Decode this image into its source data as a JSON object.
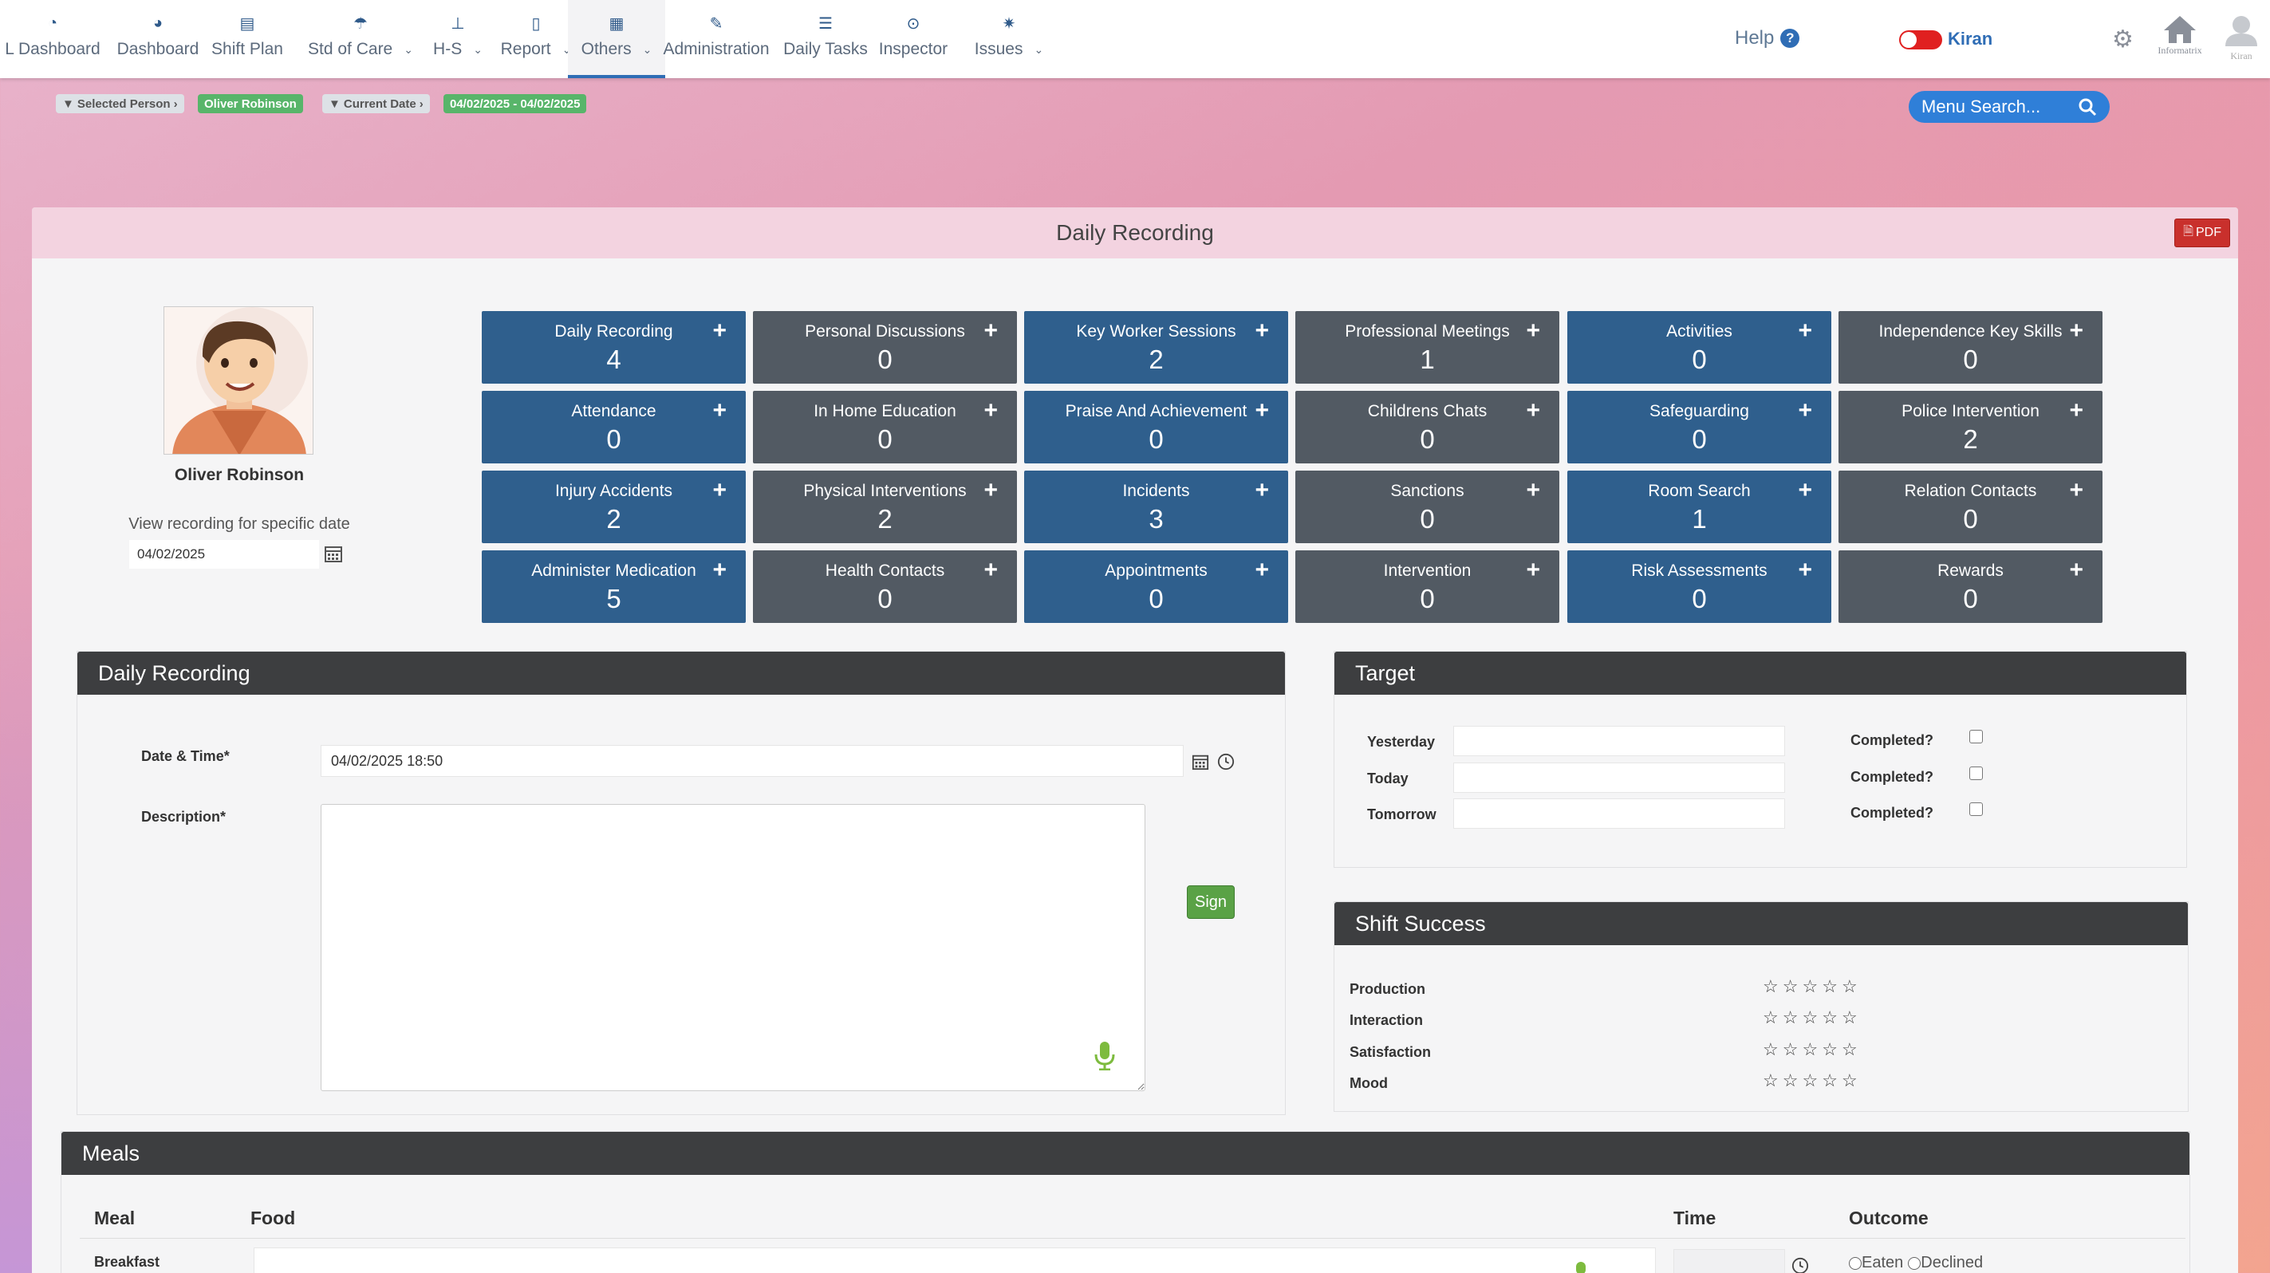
{
  "nav": {
    "items": [
      {
        "label": "L Dashboard",
        "icon": "gauge-icon",
        "caret": false
      },
      {
        "label": "Dashboard",
        "icon": "speedometer-icon",
        "caret": false
      },
      {
        "label": "Shift Plan",
        "icon": "calendar-icon",
        "caret": false
      },
      {
        "label": "Std of Care",
        "icon": "umbrella-icon",
        "caret": true
      },
      {
        "label": "H-S",
        "icon": "extinguisher-icon",
        "caret": true
      },
      {
        "label": "Report",
        "icon": "document-icon",
        "caret": true
      },
      {
        "label": "Others",
        "icon": "grid-icon",
        "caret": true,
        "active": true
      },
      {
        "label": "Administration",
        "icon": "wrench-icon",
        "caret": false
      },
      {
        "label": "Daily Tasks",
        "icon": "tasks-icon",
        "caret": false
      },
      {
        "label": "Inspector",
        "icon": "magnifier-icon",
        "caret": false
      },
      {
        "label": "Issues",
        "icon": "bug-icon",
        "caret": true
      }
    ],
    "help": "Help",
    "user": "Kiran",
    "home_caption": "Informatrix",
    "avatar_caption": "Kiran"
  },
  "filters": {
    "selected_person_label": "Selected Person",
    "selected_person_value": "Oliver Robinson",
    "current_date_label": "Current Date",
    "current_date_value": "04/02/2025 - 04/02/2025"
  },
  "menu_search": {
    "placeholder": "Menu Search..."
  },
  "panel": {
    "title": "Daily Recording",
    "pdf_label": "PDF"
  },
  "profile": {
    "name": "Oliver Robinson",
    "view_label": "View recording for specific date",
    "date": "04/02/2025"
  },
  "tiles": [
    {
      "label": "Daily Recording",
      "count": "4",
      "color": "blue"
    },
    {
      "label": "Personal Discussions",
      "count": "0",
      "color": "grey"
    },
    {
      "label": "Key Worker Sessions",
      "count": "2",
      "color": "blue"
    },
    {
      "label": "Professional Meetings",
      "count": "1",
      "color": "grey"
    },
    {
      "label": "Activities",
      "count": "0",
      "color": "blue"
    },
    {
      "label": "Independence Key Skills",
      "count": "0",
      "color": "grey"
    },
    {
      "label": "Attendance",
      "count": "0",
      "color": "blue"
    },
    {
      "label": "In Home Education",
      "count": "0",
      "color": "grey"
    },
    {
      "label": "Praise And Achievement",
      "count": "0",
      "color": "blue"
    },
    {
      "label": "Childrens Chats",
      "count": "0",
      "color": "grey"
    },
    {
      "label": "Safeguarding",
      "count": "0",
      "color": "blue"
    },
    {
      "label": "Police Intervention",
      "count": "2",
      "color": "grey"
    },
    {
      "label": "Injury Accidents",
      "count": "2",
      "color": "blue"
    },
    {
      "label": "Physical Interventions",
      "count": "2",
      "color": "grey"
    },
    {
      "label": "Incidents",
      "count": "3",
      "color": "blue"
    },
    {
      "label": "Sanctions",
      "count": "0",
      "color": "grey"
    },
    {
      "label": "Room Search",
      "count": "1",
      "color": "blue"
    },
    {
      "label": "Relation Contacts",
      "count": "0",
      "color": "grey"
    },
    {
      "label": "Administer Medication",
      "count": "5",
      "color": "blue"
    },
    {
      "label": "Health Contacts",
      "count": "0",
      "color": "grey"
    },
    {
      "label": "Appointments",
      "count": "0",
      "color": "blue"
    },
    {
      "label": "Intervention",
      "count": "0",
      "color": "grey"
    },
    {
      "label": "Risk Assessments",
      "count": "0",
      "color": "blue"
    },
    {
      "label": "Rewards",
      "count": "0",
      "color": "grey"
    }
  ],
  "daily_form": {
    "title": "Daily Recording",
    "datetime_label": "Date & Time*",
    "datetime_value": "04/02/2025 18:50",
    "description_label": "Description*",
    "description_value": "",
    "sign_label": "Sign"
  },
  "target": {
    "title": "Target",
    "rows": [
      {
        "label": "Yesterday",
        "value": "",
        "completed_label": "Completed?",
        "checked": false
      },
      {
        "label": "Today",
        "value": "",
        "completed_label": "Completed?",
        "checked": false
      },
      {
        "label": "Tomorrow",
        "value": "",
        "completed_label": "Completed?",
        "checked": false
      }
    ]
  },
  "shift_success": {
    "title": "Shift Success",
    "rows": [
      {
        "label": "Production",
        "rating": 0,
        "max": 5
      },
      {
        "label": "Interaction",
        "rating": 0,
        "max": 5
      },
      {
        "label": "Satisfaction",
        "rating": 0,
        "max": 5
      },
      {
        "label": "Mood",
        "rating": 0,
        "max": 5
      }
    ]
  },
  "meals": {
    "title": "Meals",
    "headers": {
      "meal": "Meal",
      "food": "Food",
      "time": "Time",
      "outcome": "Outcome"
    },
    "rows": [
      {
        "meal": "Breakfast",
        "food": "",
        "time": "",
        "options": [
          "Eaten",
          "Declined"
        ]
      }
    ]
  },
  "colors": {
    "tile_blue": "#2f5f8d",
    "tile_grey": "#525a63",
    "accent": "#2f6db5",
    "sign_green": "#5aa246"
  }
}
